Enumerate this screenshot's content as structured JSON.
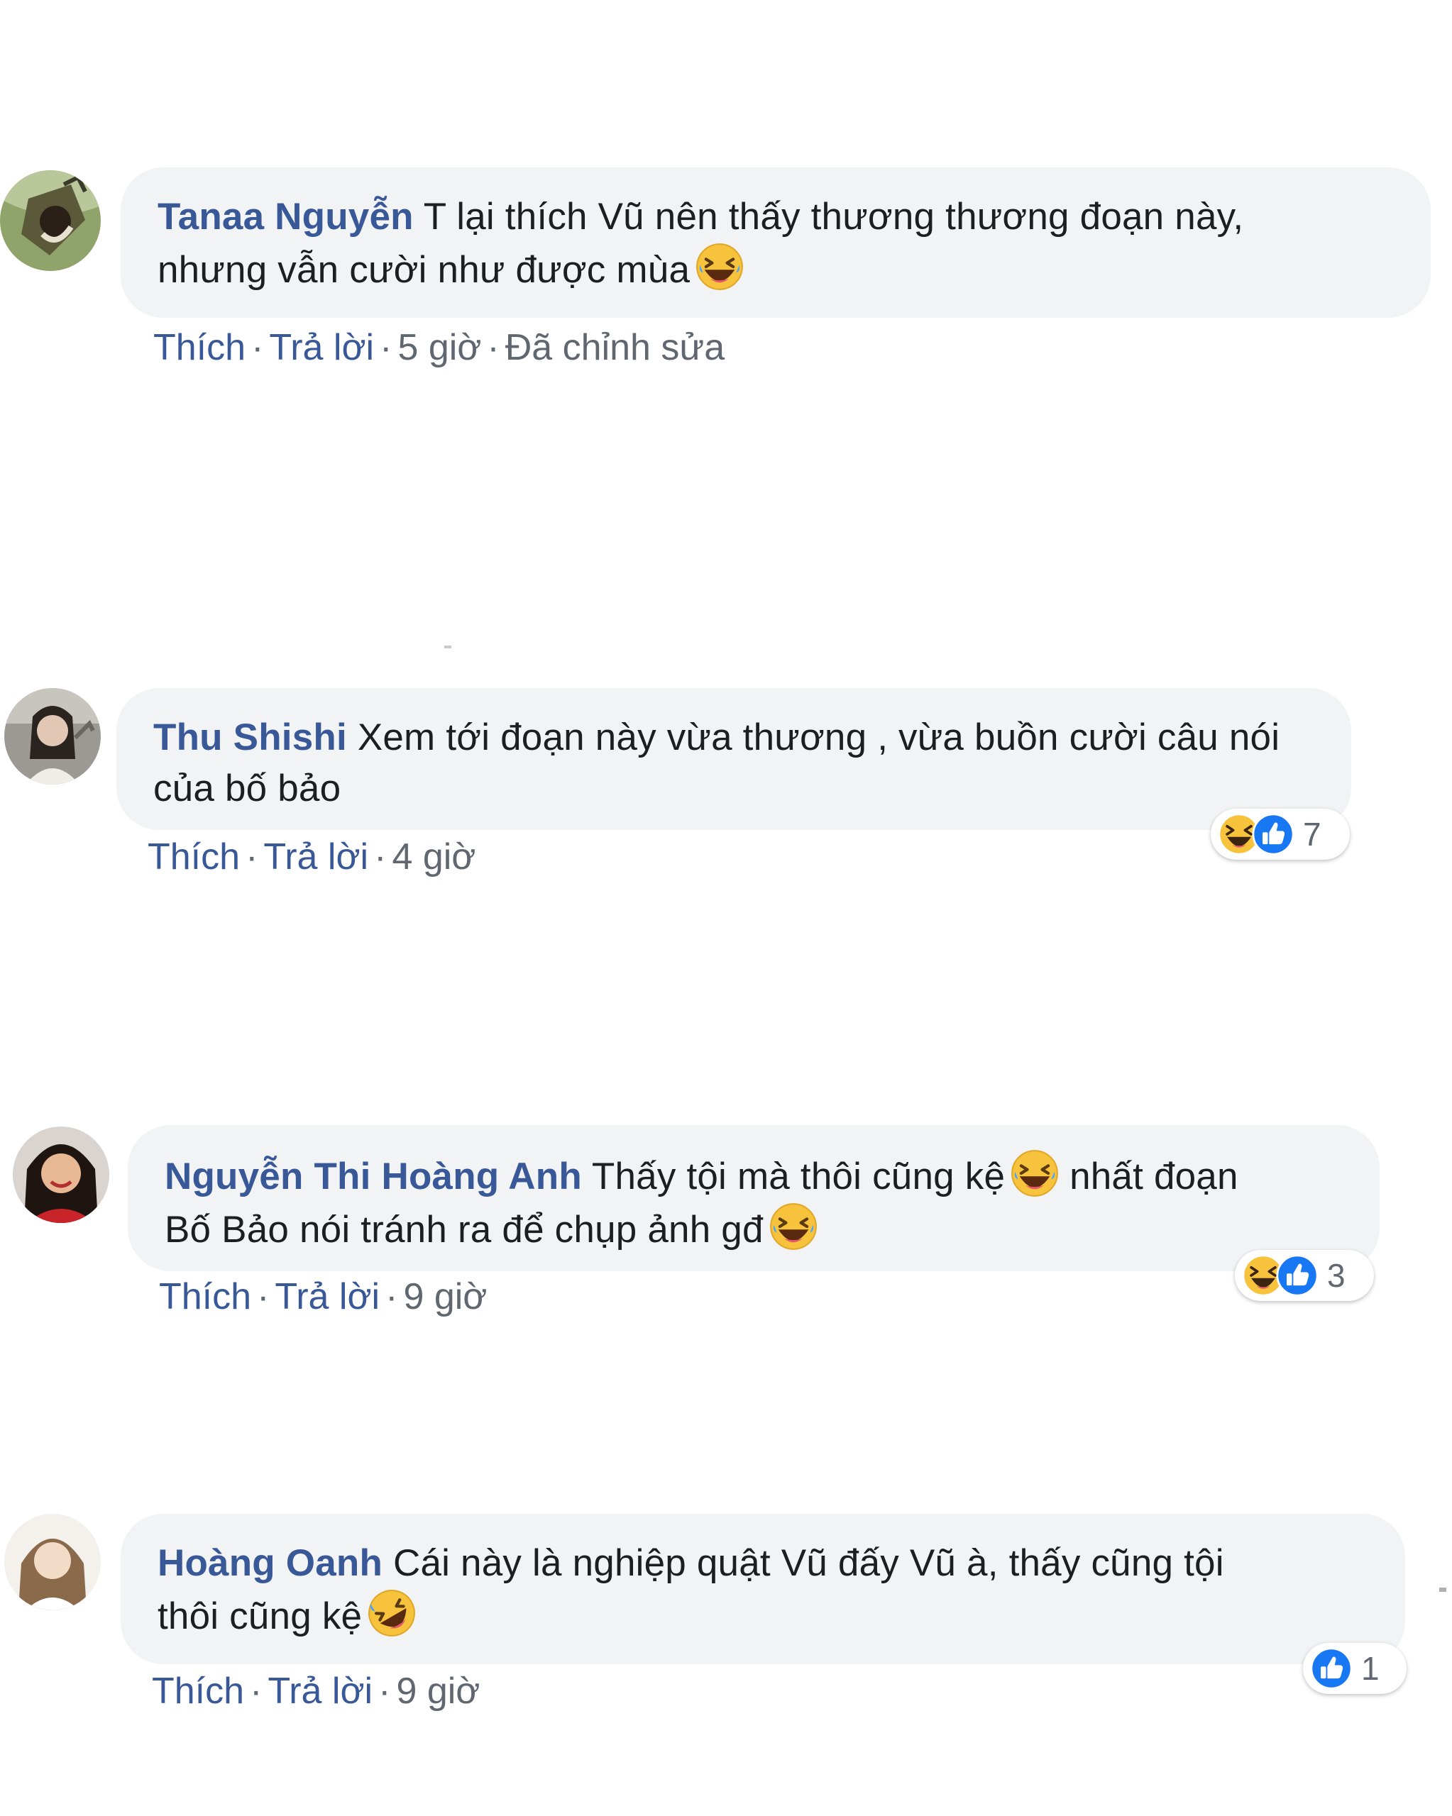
{
  "comments": [
    {
      "author": "Tanaa Nguyễn",
      "text_line1": "T lại thích Vũ nên thấy thương thương đoạn này,",
      "text_line2": "nhưng vẫn cười như được mùa",
      "emoji": "laughing-tears-emoji",
      "like": "Thích",
      "reply": "Trả lời",
      "time": "5 giờ",
      "edited": "Đã chỉnh sửa"
    },
    {
      "author": "Thu Shishi",
      "text_line1": "Xem tới đoạn này vừa thương , vừa buồn cười câu nói",
      "text_line2": "của bố bảo",
      "like": "Thích",
      "reply": "Trả lời",
      "time": "4 giờ",
      "reaction_icons": [
        "haha-icon",
        "like-icon"
      ],
      "reaction_count": "7"
    },
    {
      "author": "Nguyễn Thi Hoàng Anh",
      "text_line1_a": "Thấy tội mà thôi cũng kệ",
      "text_line1_b": "nhất đoạn",
      "text_line2": "Bố Bảo nói tránh ra để chụp ảnh gđ",
      "emoji": "laughing-tears-emoji",
      "like": "Thích",
      "reply": "Trả lời",
      "time": "9 giờ",
      "reaction_icons": [
        "haha-icon",
        "like-icon"
      ],
      "reaction_count": "3"
    },
    {
      "author": "Hoàng Oanh",
      "text_line1": "Cái này là nghiệp quật Vũ đấy Vũ à, thấy cũng tội",
      "text_line2": "thôi cũng kệ",
      "emoji": "rolling-laughing-emoji",
      "like": "Thích",
      "reply": "Trả lời",
      "time": "9 giờ",
      "reaction_icons": [
        "like-icon"
      ],
      "reaction_count": "1"
    }
  ],
  "colors": {
    "author": "#385898",
    "link": "#385898",
    "meta": "#606770",
    "bubble": "#f2f3f5",
    "like_blue": "#1877f2",
    "emoji_yellow": "#f7c23c"
  }
}
